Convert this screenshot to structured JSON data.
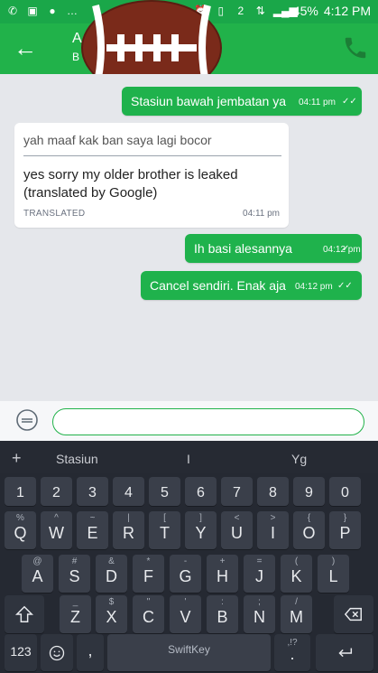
{
  "status_bar": {
    "left_icons": [
      "whatsapp-icon",
      "gallery-icon",
      "chat-icon",
      "more-dots"
    ],
    "right_icons": [
      "alarm-icon",
      "vibrate-icon",
      "sim-2-icon",
      "data-arrows-icon",
      "signal-icon"
    ],
    "sim_label": "2",
    "battery": "45%",
    "time": "4:12 PM"
  },
  "app_bar": {
    "title": "A",
    "subtitle": "B"
  },
  "messages": [
    {
      "type": "out",
      "text": "Stasiun bawah jembatan ya",
      "time": "04:11 pm",
      "status": "read"
    },
    {
      "type": "in",
      "original": "yah maaf kak ban saya lagi bocor",
      "translation": "yes sorry my older brother is leaked (translated by Google)",
      "label": "TRANSLATED",
      "time": "04:11 pm"
    },
    {
      "type": "out",
      "text": "Ih basi alesannya",
      "time": "04:12 pm",
      "status": "sent"
    },
    {
      "type": "out",
      "text": "Cancel sendiri. Enak aja",
      "time": "04:12 pm",
      "status": "read"
    }
  ],
  "composer": {
    "placeholder": "",
    "value": ""
  },
  "keyboard": {
    "suggestions": [
      "Stasiun",
      "I",
      "Yg"
    ],
    "plus": "+",
    "numbers": [
      {
        "main": "1",
        "alt": ""
      },
      {
        "main": "2",
        "alt": ""
      },
      {
        "main": "3",
        "alt": ""
      },
      {
        "main": "4",
        "alt": ""
      },
      {
        "main": "5",
        "alt": ""
      },
      {
        "main": "6",
        "alt": ""
      },
      {
        "main": "7",
        "alt": ""
      },
      {
        "main": "8",
        "alt": ""
      },
      {
        "main": "9",
        "alt": ""
      },
      {
        "main": "0",
        "alt": ""
      }
    ],
    "row1": [
      {
        "main": "Q",
        "alt": "%"
      },
      {
        "main": "W",
        "alt": "^"
      },
      {
        "main": "E",
        "alt": "~"
      },
      {
        "main": "R",
        "alt": "|"
      },
      {
        "main": "T",
        "alt": "["
      },
      {
        "main": "Y",
        "alt": "]"
      },
      {
        "main": "U",
        "alt": "<"
      },
      {
        "main": "I",
        "alt": ">"
      },
      {
        "main": "O",
        "alt": "{"
      },
      {
        "main": "P",
        "alt": "}"
      }
    ],
    "row2": [
      {
        "main": "A",
        "alt": "@"
      },
      {
        "main": "S",
        "alt": "#"
      },
      {
        "main": "D",
        "alt": "&"
      },
      {
        "main": "F",
        "alt": "*"
      },
      {
        "main": "G",
        "alt": "-"
      },
      {
        "main": "H",
        "alt": "+"
      },
      {
        "main": "J",
        "alt": "="
      },
      {
        "main": "K",
        "alt": "("
      },
      {
        "main": "L",
        "alt": ")"
      }
    ],
    "row3": [
      {
        "main": "Z",
        "alt": "_"
      },
      {
        "main": "X",
        "alt": "$"
      },
      {
        "main": "C",
        "alt": "\""
      },
      {
        "main": "V",
        "alt": "'"
      },
      {
        "main": "B",
        "alt": ":"
      },
      {
        "main": "N",
        "alt": ";"
      },
      {
        "main": "M",
        "alt": "/"
      }
    ],
    "shift": "shift",
    "backspace": "backspace",
    "mode": "123",
    "comma": ",",
    "space_label": "SwiftKey",
    "period": ".",
    "period_alt": ",!?",
    "enter": "enter"
  }
}
